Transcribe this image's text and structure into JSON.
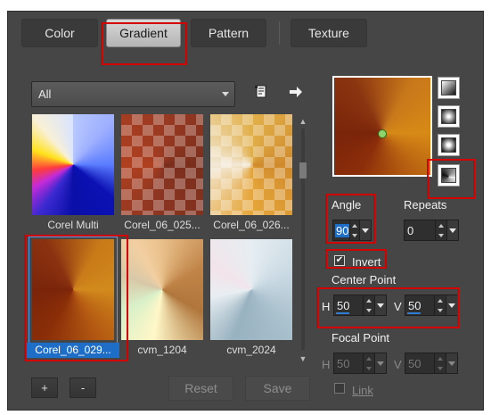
{
  "tabs": [
    {
      "label": "Color",
      "active": false
    },
    {
      "label": "Gradient",
      "active": true
    },
    {
      "label": "Pattern",
      "active": false
    },
    {
      "label": "Texture",
      "active": false
    }
  ],
  "filter": {
    "selected": "All"
  },
  "icons": {
    "edit": "gradient-editor-icon",
    "next": "arrow-right-icon"
  },
  "gradients": [
    {
      "name": "Corel Multi",
      "selected": false
    },
    {
      "name": "Corel_06_025...",
      "selected": false
    },
    {
      "name": "Corel_06_026...",
      "selected": false
    },
    {
      "name": "Corel_06_029...",
      "selected": true
    },
    {
      "name": "cvm_1204",
      "selected": false
    },
    {
      "name": "cvm_2024",
      "selected": false
    }
  ],
  "buttons": {
    "add": "+",
    "remove": "-",
    "reset": "Reset",
    "save": "Save"
  },
  "styles": [
    "linear",
    "rectangular",
    "sunburst",
    "corner-angle"
  ],
  "selected_style": "corner-angle",
  "angle": {
    "label": "Angle",
    "value": "90"
  },
  "repeats": {
    "label": "Repeats",
    "value": "0"
  },
  "invert": {
    "label": "Invert",
    "checked": true
  },
  "center_point": {
    "label": "Center Point",
    "h_label": "H",
    "h_value": "50",
    "v_label": "V",
    "v_value": "50"
  },
  "focal_point": {
    "label": "Focal Point",
    "h_label": "H",
    "h_value": "50",
    "v_label": "V",
    "v_value": "50"
  },
  "link": {
    "label": "Link",
    "checked": false
  },
  "colors": {
    "accent": "#1e6ec8",
    "highlight": "#d40000",
    "gradient_light": "#dc9a28",
    "gradient_dark": "#7a2e0c"
  }
}
